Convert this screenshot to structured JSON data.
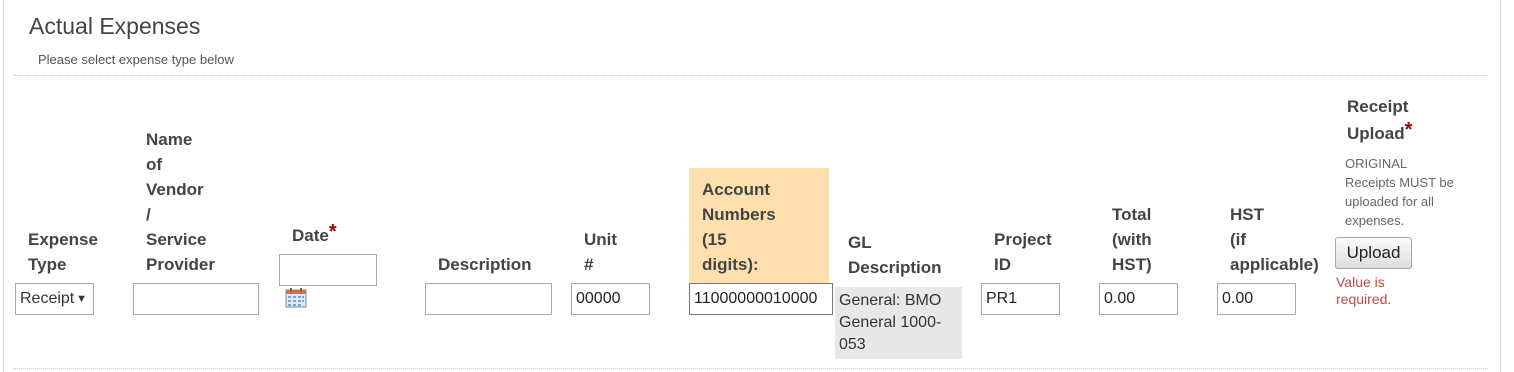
{
  "section": {
    "title": "Actual Expenses",
    "subtitle": "Please select expense type below"
  },
  "columns": {
    "expense_type": [
      "Expense",
      "Type"
    ],
    "vendor": [
      "Name",
      "of",
      "Vendor",
      "/",
      "Service",
      "Provider"
    ],
    "date": "Date",
    "description": "Description",
    "unit": [
      "Unit",
      "#"
    ],
    "account": [
      "Account",
      "Numbers",
      "(15",
      "digits):"
    ],
    "gl": [
      "GL",
      "Description"
    ],
    "project": [
      "Project",
      "ID"
    ],
    "total": [
      "Total",
      "(with",
      "HST)"
    ],
    "hst": [
      "HST",
      "(if",
      "applicable)"
    ],
    "receipt": [
      "Receipt",
      "Upload"
    ],
    "required_mark": "*"
  },
  "row": {
    "expense_type_value": "Receipt",
    "vendor_value": "",
    "date_value": "",
    "description_value": "",
    "unit_value": "00000",
    "account_value": "11000000010000",
    "gl_description": "General: BMO General 1000-053",
    "project_value": "PR1",
    "total_value": "0.00",
    "hst_value": "0.00"
  },
  "receipt": {
    "note": "ORIGINAL Receipts MUST be uploaded for all expenses.",
    "upload_label": "Upload",
    "error": "Value is required."
  },
  "icons": {
    "date_picker": "calendar-icon",
    "dropdown": "chevron-down-icon"
  },
  "colors": {
    "account_highlight": "#fde0ae",
    "required": "#990000",
    "error": "#b94a48",
    "gl_background": "#e8e8e8"
  }
}
